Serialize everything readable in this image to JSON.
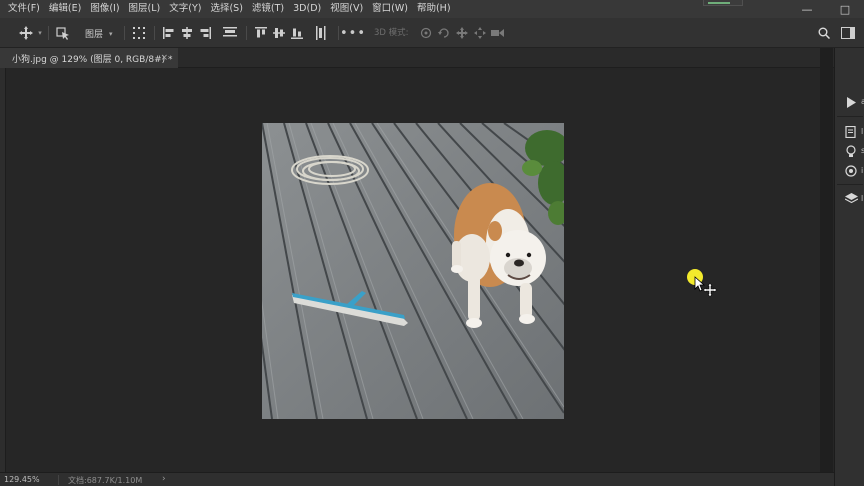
{
  "menubar": {
    "items": [
      "文件(F)",
      "编辑(E)",
      "图像(I)",
      "图层(L)",
      "文字(Y)",
      "选择(S)",
      "滤镜(T)",
      "3D(D)",
      "视图(V)",
      "窗口(W)",
      "帮助(H)"
    ],
    "window_controls": [
      "—",
      "□"
    ]
  },
  "optionsbar": {
    "layer_dropdown": "图层",
    "mode_3d": "3D 模式:"
  },
  "document": {
    "tab_title": "小狗.jpg @ 129% (图层 0, RGB/8#) *",
    "close": "×"
  },
  "right_panel": {
    "labels": [
      "a",
      "l",
      "s",
      "i",
      "l"
    ]
  },
  "statusbar": {
    "zoom": "129.45%",
    "doc_size": "文档:687.7K/1.10M",
    "arrow": "›"
  },
  "icons": [
    "move-tool-icon",
    "transform-icon",
    "align-icon",
    "distribute-icon",
    "more-icon",
    "3d-orbit-icon",
    "search-icon",
    "workspace-icon",
    "play-icon",
    "properties-icon",
    "lightbulb-icon",
    "libraries-icon",
    "layers-icon"
  ]
}
